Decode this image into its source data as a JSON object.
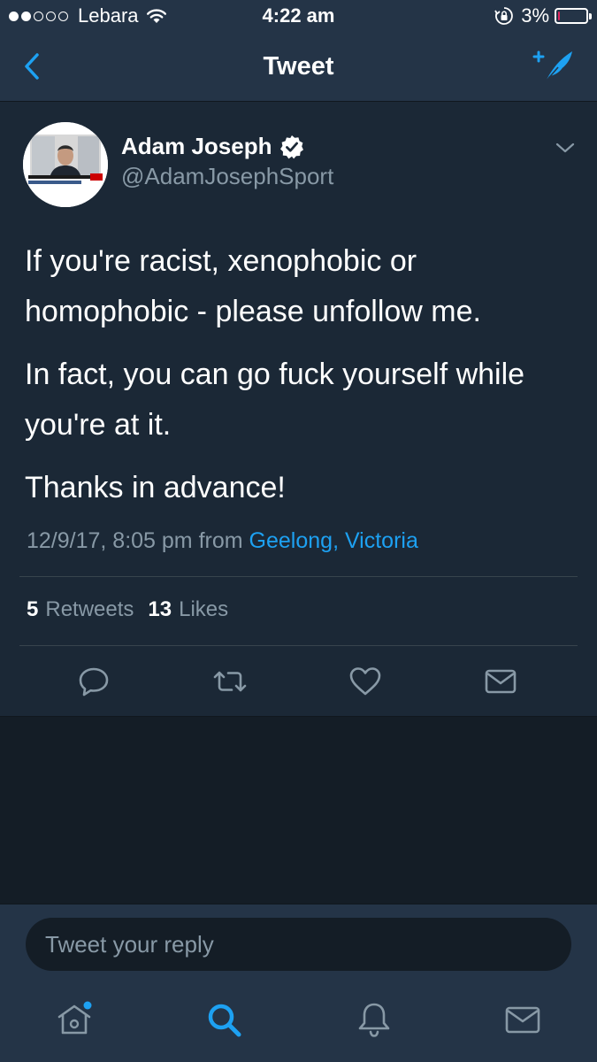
{
  "status_bar": {
    "carrier": "Lebara",
    "time": "4:22 am",
    "battery_percent_label": "3%",
    "battery_level": 0.03,
    "signal_bars_filled": 2,
    "signal_bars_total": 5
  },
  "nav": {
    "title": "Tweet",
    "back_icon": "chevron-left-icon",
    "compose_icon": "compose-feather-icon"
  },
  "tweet": {
    "author_name": "Adam Joseph",
    "author_handle": "@AdamJosephSport",
    "verified": true,
    "paragraphs": [
      "If you're racist, xenophobic or homophobic - please unfollow me.",
      "In fact, you can go fuck yourself while you're at it.",
      "Thanks in advance!"
    ],
    "timestamp": "12/9/17, 8:05 pm",
    "from_label": "from",
    "location": "Geelong, Victoria",
    "retweets_count": "5",
    "retweets_label": "Retweets",
    "likes_count": "13",
    "likes_label": "Likes"
  },
  "reply": {
    "placeholder": "Tweet your reply"
  },
  "tabs": [
    {
      "icon": "home-icon",
      "active": false,
      "notification_dot": true
    },
    {
      "icon": "search-icon",
      "active": true,
      "notification_dot": false
    },
    {
      "icon": "bell-icon",
      "active": false,
      "notification_dot": false
    },
    {
      "icon": "mail-icon",
      "active": false,
      "notification_dot": false
    }
  ],
  "colors": {
    "accent": "#1da1f2",
    "background": "#141d26",
    "card": "#1b2836",
    "bar": "#243447",
    "secondary_text": "#8899a6",
    "battery_low": "#e0245e"
  }
}
